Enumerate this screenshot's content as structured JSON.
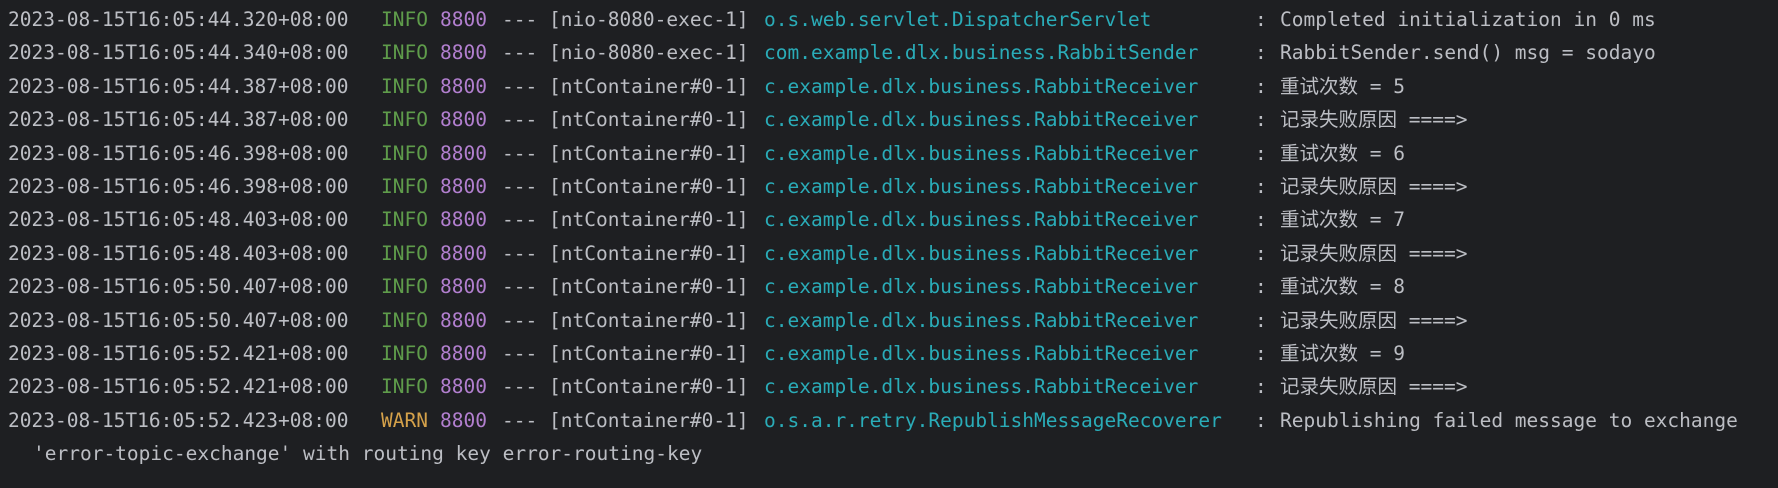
{
  "console": {
    "lines": [
      {
        "timestamp": "2023-08-15T16:05:44.320+08:00",
        "level": "INFO",
        "pid": "8800",
        "sep": "---",
        "thread": "[nio-8080-exec-1]",
        "logger": "o.s.web.servlet.DispatcherServlet",
        "message": "Completed initialization in 0 ms"
      },
      {
        "timestamp": "2023-08-15T16:05:44.340+08:00",
        "level": "INFO",
        "pid": "8800",
        "sep": "---",
        "thread": "[nio-8080-exec-1]",
        "logger": "com.example.dlx.business.RabbitSender",
        "message": "RabbitSender.send() msg = sodayo"
      },
      {
        "timestamp": "2023-08-15T16:05:44.387+08:00",
        "level": "INFO",
        "pid": "8800",
        "sep": "---",
        "thread": "[ntContainer#0-1]",
        "logger": "c.example.dlx.business.RabbitReceiver",
        "message": "重试次数 = 5"
      },
      {
        "timestamp": "2023-08-15T16:05:44.387+08:00",
        "level": "INFO",
        "pid": "8800",
        "sep": "---",
        "thread": "[ntContainer#0-1]",
        "logger": "c.example.dlx.business.RabbitReceiver",
        "message": "记录失败原因 ====>"
      },
      {
        "timestamp": "2023-08-15T16:05:46.398+08:00",
        "level": "INFO",
        "pid": "8800",
        "sep": "---",
        "thread": "[ntContainer#0-1]",
        "logger": "c.example.dlx.business.RabbitReceiver",
        "message": "重试次数 = 6"
      },
      {
        "timestamp": "2023-08-15T16:05:46.398+08:00",
        "level": "INFO",
        "pid": "8800",
        "sep": "---",
        "thread": "[ntContainer#0-1]",
        "logger": "c.example.dlx.business.RabbitReceiver",
        "message": "记录失败原因 ====>"
      },
      {
        "timestamp": "2023-08-15T16:05:48.403+08:00",
        "level": "INFO",
        "pid": "8800",
        "sep": "---",
        "thread": "[ntContainer#0-1]",
        "logger": "c.example.dlx.business.RabbitReceiver",
        "message": "重试次数 = 7"
      },
      {
        "timestamp": "2023-08-15T16:05:48.403+08:00",
        "level": "INFO",
        "pid": "8800",
        "sep": "---",
        "thread": "[ntContainer#0-1]",
        "logger": "c.example.dlx.business.RabbitReceiver",
        "message": "记录失败原因 ====>"
      },
      {
        "timestamp": "2023-08-15T16:05:50.407+08:00",
        "level": "INFO",
        "pid": "8800",
        "sep": "---",
        "thread": "[ntContainer#0-1]",
        "logger": "c.example.dlx.business.RabbitReceiver",
        "message": "重试次数 = 8"
      },
      {
        "timestamp": "2023-08-15T16:05:50.407+08:00",
        "level": "INFO",
        "pid": "8800",
        "sep": "---",
        "thread": "[ntContainer#0-1]",
        "logger": "c.example.dlx.business.RabbitReceiver",
        "message": "记录失败原因 ====>"
      },
      {
        "timestamp": "2023-08-15T16:05:52.421+08:00",
        "level": "INFO",
        "pid": "8800",
        "sep": "---",
        "thread": "[ntContainer#0-1]",
        "logger": "c.example.dlx.business.RabbitReceiver",
        "message": "重试次数 = 9"
      },
      {
        "timestamp": "2023-08-15T16:05:52.421+08:00",
        "level": "INFO",
        "pid": "8800",
        "sep": "---",
        "thread": "[ntContainer#0-1]",
        "logger": "c.example.dlx.business.RabbitReceiver",
        "message": "记录失败原因 ====>"
      },
      {
        "timestamp": "2023-08-15T16:05:52.423+08:00",
        "level": "WARN",
        "pid": "8800",
        "sep": "---",
        "thread": "[ntContainer#0-1]",
        "logger": "o.s.a.r.retry.RepublishMessageRecoverer",
        "message": "Republishing failed message to exchange"
      }
    ],
    "continuation": "'error-topic-exchange' with routing key error-routing-key",
    "colon": ":",
    "colors": {
      "background": "#1e1f22",
      "text": "#bcbec4",
      "info": "#5f9c4b",
      "warn": "#d5a14a",
      "pid": "#b27fcf",
      "logger": "#2aacb8"
    }
  }
}
